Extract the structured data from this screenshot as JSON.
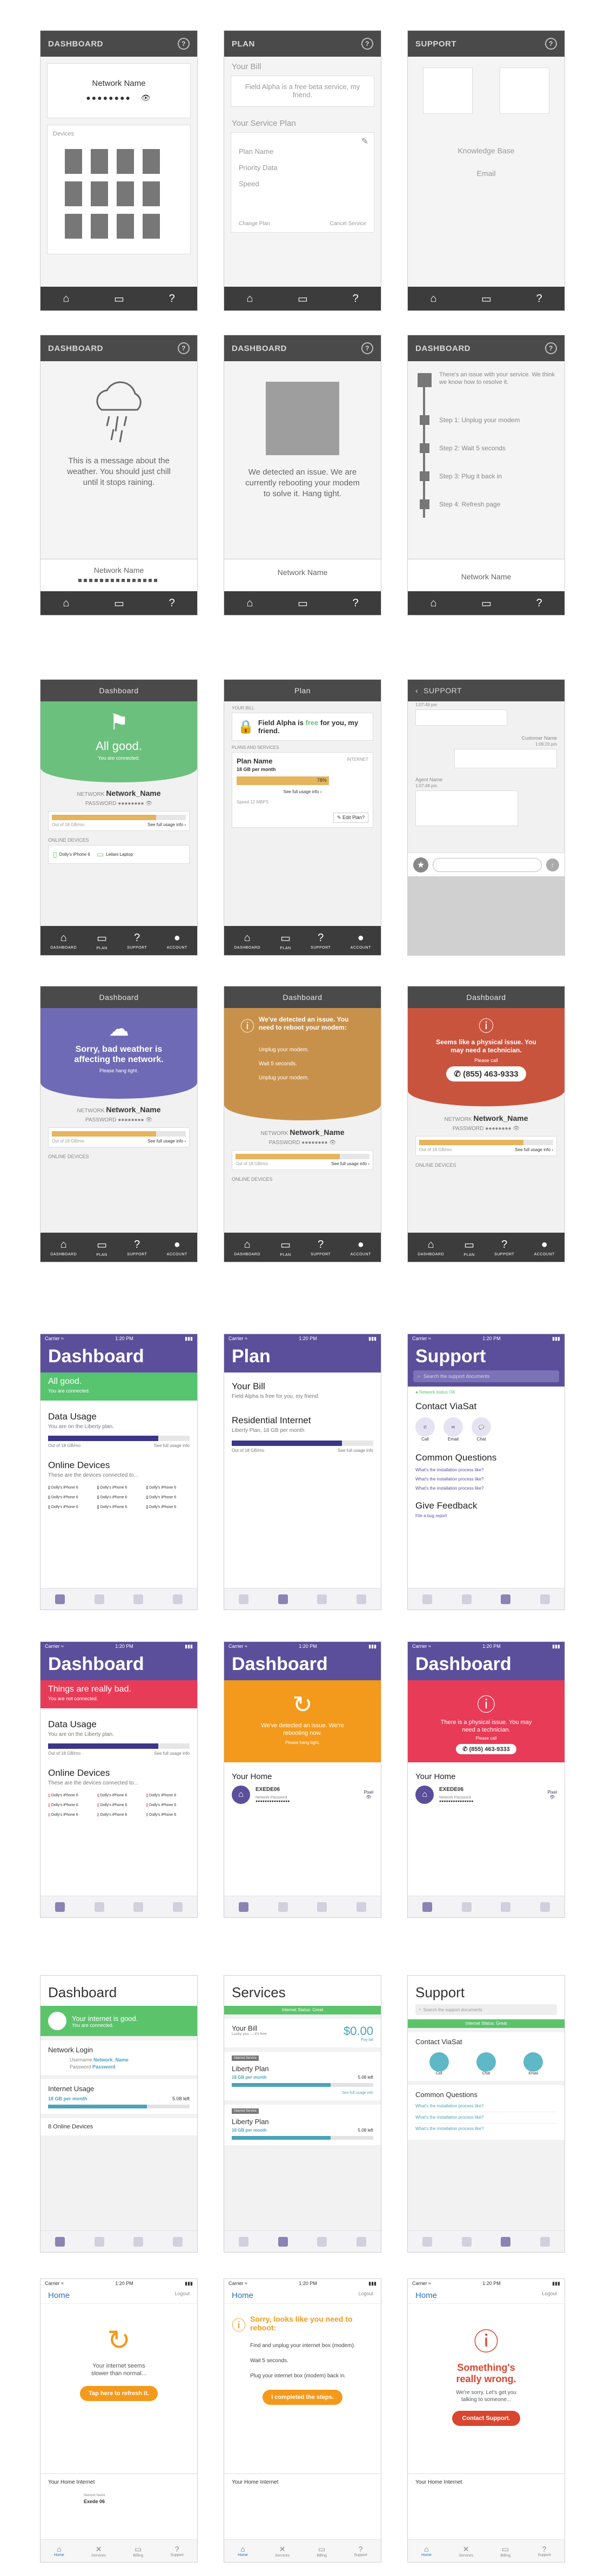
{
  "row1": {
    "dashboard": {
      "title": "DASHBOARD",
      "help": "?",
      "network_label": "Network Name",
      "password_dots": "●●●●●●●●",
      "devices_label": "Devices"
    },
    "plan": {
      "title": "PLAN",
      "help": "?",
      "your_bill": "Your Bill",
      "bill_text": "Field Alpha is a free beta service, my friend.",
      "service_plan": "Your Service Plan",
      "items": [
        "Plan Name",
        "Priority Data",
        "Speed"
      ],
      "change_plan": "Change Plan",
      "cancel_service": "Cancel Service"
    },
    "support": {
      "title": "SUPPORT",
      "help": "?",
      "knowledge_base": "Knowledge Base",
      "email": "Email"
    }
  },
  "row2": {
    "weather": {
      "title": "DASHBOARD",
      "help": "?",
      "message": "This is a message about the weather. You should just chill until it stops raining.",
      "network_label": "Network Name"
    },
    "reboot": {
      "title": "DASHBOARD",
      "help": "?",
      "message": "We detected an issue. We are currently rebooting your modem to solve it. Hang tight.",
      "network_label": "Network Name"
    },
    "steps": {
      "title": "DASHBOARD",
      "help": "?",
      "intro": "There's an issue with your service. We think we know how to resolve it.",
      "steps": [
        "Step 1: Unplug your modem",
        "Step 2: Wait 5 seconds",
        "Step 3: Plug it back in",
        "Step 4: Refresh page"
      ],
      "network_label": "Network Name"
    }
  },
  "row3": {
    "tabs": [
      "DASHBOARD",
      "PLAN",
      "SUPPORT",
      "ACCOUNT"
    ],
    "good": {
      "header": "Dashboard",
      "status": "All good.",
      "sub": "You are connected.",
      "network_key": "NETWORK",
      "network_value": "Network_Name",
      "password_key": "PASSWORD",
      "usage_text": "Out of 18 GB/mo",
      "usage_link": "See full usage info ›",
      "usage_pct": 0.78,
      "online_devices": "ONLINE DEVICES",
      "devices": [
        "Dolly's iPhone 6",
        "Leilani Laptop"
      ]
    },
    "plan": {
      "header": "Plan",
      "your_bill": "YOUR BILL",
      "bill_text_a": "Field Alpha is ",
      "bill_free": "free",
      "bill_text_b": " for you, my friend.",
      "plans_label": "PLANS AND SERVICES",
      "plan_name": "Plan Name",
      "plan_type": "INTERNET",
      "plan_desc": "18 GB per month",
      "pct": "78%",
      "usage_link": "See full usage info ›",
      "speed": "Speed 12 MBPS",
      "edit": "✎ Edit Plan?"
    },
    "support": {
      "header": "SUPPORT",
      "back": "‹",
      "time1": "1:07:49 pm",
      "cust_name": "Customer Name",
      "time2": "1:06:20 pm",
      "agent_name": "Agent Name",
      "time3": "1:07:48 pm"
    }
  },
  "row4": {
    "tabs": [
      "DASHBOARD",
      "PLAN",
      "SUPPORT",
      "ACCOUNT"
    ],
    "weather": {
      "header": "Dashboard",
      "status": "Sorry, bad weather is affecting the network.",
      "sub": "Please hang tight.",
      "network_key": "NETWORK",
      "network_value": "Network_Name",
      "password_key": "PASSWORD",
      "usage_text": "Out of 18 GB/mo",
      "usage_link": "See full usage info ›",
      "online_devices": "ONLINE DEVICES"
    },
    "issue": {
      "header": "Dashboard",
      "status": "We've detected an issue. You need to reboot your modem:",
      "steps": [
        "Unplug your modem.",
        "Wait 5 seconds.",
        "Unplug your modem."
      ],
      "network_key": "NETWORK",
      "network_value": "Network_Name",
      "password_key": "PASSWORD",
      "usage_text": "Out of 18 GB/mo",
      "usage_link": "See full usage info ›",
      "online_devices": "ONLINE DEVICES"
    },
    "physical": {
      "header": "Dashboard",
      "status": "Seems like a physical issue. You may need a technician.",
      "please_call": "Please call",
      "phone": "(855) 463-9333",
      "network_key": "NETWORK",
      "network_value": "Network_Name",
      "password_key": "PASSWORD",
      "usage_text": "Out of 18 GB/mo",
      "usage_link": "See full usage info ›",
      "online_devices": "ONLINE DEVICES"
    }
  },
  "row5": {
    "status_carrier": "Carrier ≈",
    "status_time": "1:20 PM",
    "dash": {
      "title": "Dashboard",
      "banner": "All good.",
      "banner_sub": "You are connected.",
      "usage_title": "Data Usage",
      "usage_sub": "You are on the Liberty plan.",
      "usage_left": "Out of 18 GB/mo",
      "usage_right": "See full usage info",
      "devices_title": "Online Devices",
      "devices_sub": "These are the devices connected to...",
      "devices": [
        "Dolly's iPhone 6",
        "Dolly's iPhone 6",
        "Dolly's iPhone 6",
        "Dolly's iPhone 6",
        "Dolly's iPhone 6",
        "Dolly's iPhone 6",
        "Dolly's iPhone 6",
        "Dolly's iPhone 6",
        "Dolly's iPhone 6"
      ]
    },
    "plan": {
      "title": "Plan",
      "bill_title": "Your Bill",
      "bill_sub": "Field Alpha is free for you, my friend.",
      "res_title": "Residential Internet",
      "res_sub": "Liberty Plan, 18 GB per month",
      "res_left": "Out of 18 GB/mo",
      "res_right": "See full usage info"
    },
    "support": {
      "title": "Support",
      "search": "Search the support documents",
      "network_status": "● Network status OK",
      "contact": "Contact ViaSat",
      "contact_items": [
        "Call",
        "Email",
        "Chat"
      ],
      "faq_title": "Common Questions",
      "faqs": [
        "What's the installation process like?",
        "What's the installation process like?",
        "What's the installation process like?"
      ],
      "feedback_title": "Give Feedback",
      "feedback_link": "File a bug report"
    }
  },
  "row6": {
    "status_carrier": "Carrier ≈",
    "status_time": "1:20 PM",
    "bad": {
      "title": "Dashboard",
      "banner": "Things are really bad.",
      "banner_sub": "You are not connected.",
      "usage_title": "Data Usage",
      "usage_sub": "You are on the Liberty plan.",
      "usage_left": "Out of 18 GB/mo",
      "usage_right": "See full usage info",
      "devices_title": "Online Devices",
      "devices_sub": "These are the devices connected to...",
      "devices": [
        "Dolly's iPhone 6",
        "Dolly's iPhone 6",
        "Dolly's iPhone 6",
        "Dolly's iPhone 6",
        "Dolly's iPhone 6",
        "Dolly's iPhone 6",
        "Dolly's iPhone 6",
        "Dolly's iPhone 6",
        "Dolly's iPhone 6"
      ]
    },
    "reboot": {
      "title": "Dashboard",
      "msg": "We've detected an issue. We're rebooting now.",
      "sub": "Please hang tight.",
      "home": "Your Home",
      "home_name": "EXEDE06",
      "pixel": "Pixel",
      "pw_label": "Network Password",
      "pw_dots": "●●●●●●●●●●●●●●●"
    },
    "tech": {
      "title": "Dashboard",
      "msg": "There is a physical issue. You may need a technician.",
      "please_call": "Please call",
      "phone": "(855) 463-9333",
      "home": "Your Home",
      "home_name": "EXEDE06",
      "pixel": "Pixel",
      "pw_label": "Network Password",
      "pw_dots": "●●●●●●●●●●●●●●●"
    }
  },
  "row7": {
    "dash": {
      "title": "Dashboard",
      "banner": "Your internet is good.",
      "banner_sub": "You are connected.",
      "login_title": "Network Login",
      "username_label": "Username",
      "username_value": "Network_Name",
      "password_label": "Password",
      "password_value": "Password",
      "usage_title": "Internet Usage",
      "usage_left": "18 GB per month",
      "usage_right": "5.08 left",
      "devices_title": "8 Online Devices"
    },
    "services": {
      "title": "Services",
      "status": "Internet Status: Great",
      "bill_title": "Your Bill",
      "bill_sub": "Lucky you — it's free",
      "bill_amount": "$0.00",
      "bill_link": "Pay bill",
      "tag": "Internet Service",
      "plan_title": "Liberty Plan",
      "plan_sub": "18 GB per month",
      "plan_left": "5.08 left",
      "plan_link": "See full usage info",
      "tag2": "Internet Service",
      "plan2_title": "Liberty Plan",
      "plan2_sub": "18 GB per month",
      "plan2_left": "5.08 left"
    },
    "support": {
      "title": "Support",
      "search": "Search the support documents",
      "status": "Internet Status: Great",
      "contact": "Contact ViaSat",
      "contact_items": [
        "Call",
        "Chat",
        "Email"
      ],
      "faq_title": "Common Questions",
      "faqs": [
        "What's the installation process like?",
        "What's the installation process like?",
        "What's the installation process like?"
      ]
    }
  },
  "row8": {
    "status_carrier": "Carrier ≈",
    "status_time": "1:20 PM",
    "tabs": [
      "Home",
      "Services",
      "Billing",
      "Support"
    ],
    "refresh": {
      "title": "Home",
      "logout": "Logout",
      "msg": "Your internet seems slower than normal...",
      "button": "Tap here to refresh it.",
      "section": "Your Home Internet",
      "net_label": "Network Name",
      "net_value": "Exede 06"
    },
    "reboot": {
      "title": "Home",
      "logout": "Logout",
      "heading": "Sorry, looks like you need to reboot:",
      "steps": [
        "Find and unplug your internet box (modem).",
        "Wait 5 seconds.",
        "Plug your internet box (modem) back in."
      ],
      "button": "I completed the steps.",
      "section": "Your Home Internet"
    },
    "wrong": {
      "title": "Home",
      "logout": "Logout",
      "heading": "Something's really wrong.",
      "msg": "We're sorry. Let's get you talking to someone...",
      "button": "Contact Support.",
      "section": "Your Home Internet"
    }
  }
}
